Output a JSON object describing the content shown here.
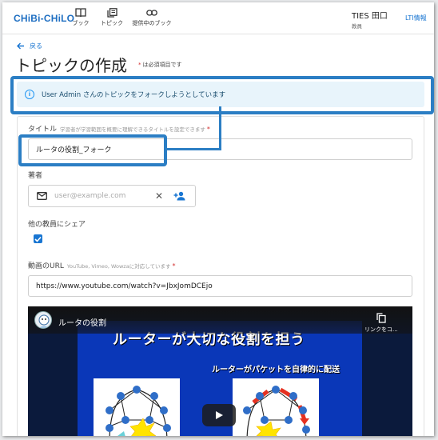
{
  "header": {
    "logo": "CHiBi-CHiLO",
    "nav": {
      "books": "ブック",
      "topics": "トピック",
      "linked_books": "提供中のブック"
    },
    "user": {
      "name": "TIES 田口",
      "role": "教員"
    },
    "lti_link": "LTI情報"
  },
  "page": {
    "back_label": "戻る",
    "title": "トピックの作成",
    "required_note": "は必須項目です",
    "required_mark": "*"
  },
  "alert": {
    "icon": "info-icon",
    "text": "User Admin さんのトピックをフォークしようとしています"
  },
  "form": {
    "title_field": {
      "label": "タイトル",
      "hint": "学習者が学習範囲を概要に理解できるタイトルを設定できます",
      "required": "*",
      "value": "ルータの役割_フォーク"
    },
    "author_field": {
      "label": "著者",
      "placeholder": "user@example.com"
    },
    "share_field": {
      "label": "他の教員にシェア",
      "checked": true
    },
    "video_url_field": {
      "label": "動画のURL",
      "hint": "YouTube, Vimeo, Wowzaに対応しています",
      "required": "*",
      "value": "https://www.youtube.com/watch?v=JbxJomDCEjo"
    }
  },
  "video": {
    "title": "ルータの役割",
    "copy_label": "リンクをコ...",
    "slide_title": "ルーターが大切な役割を担う",
    "slide_subtitle": "ルーターがパケットを自律的に配送"
  },
  "colors": {
    "primary": "#1976d2",
    "highlight": "#2b7ec4",
    "alert_bg": "#e8f4fb",
    "required": "#d32f2f",
    "slide_bg": "#0a37b8"
  }
}
